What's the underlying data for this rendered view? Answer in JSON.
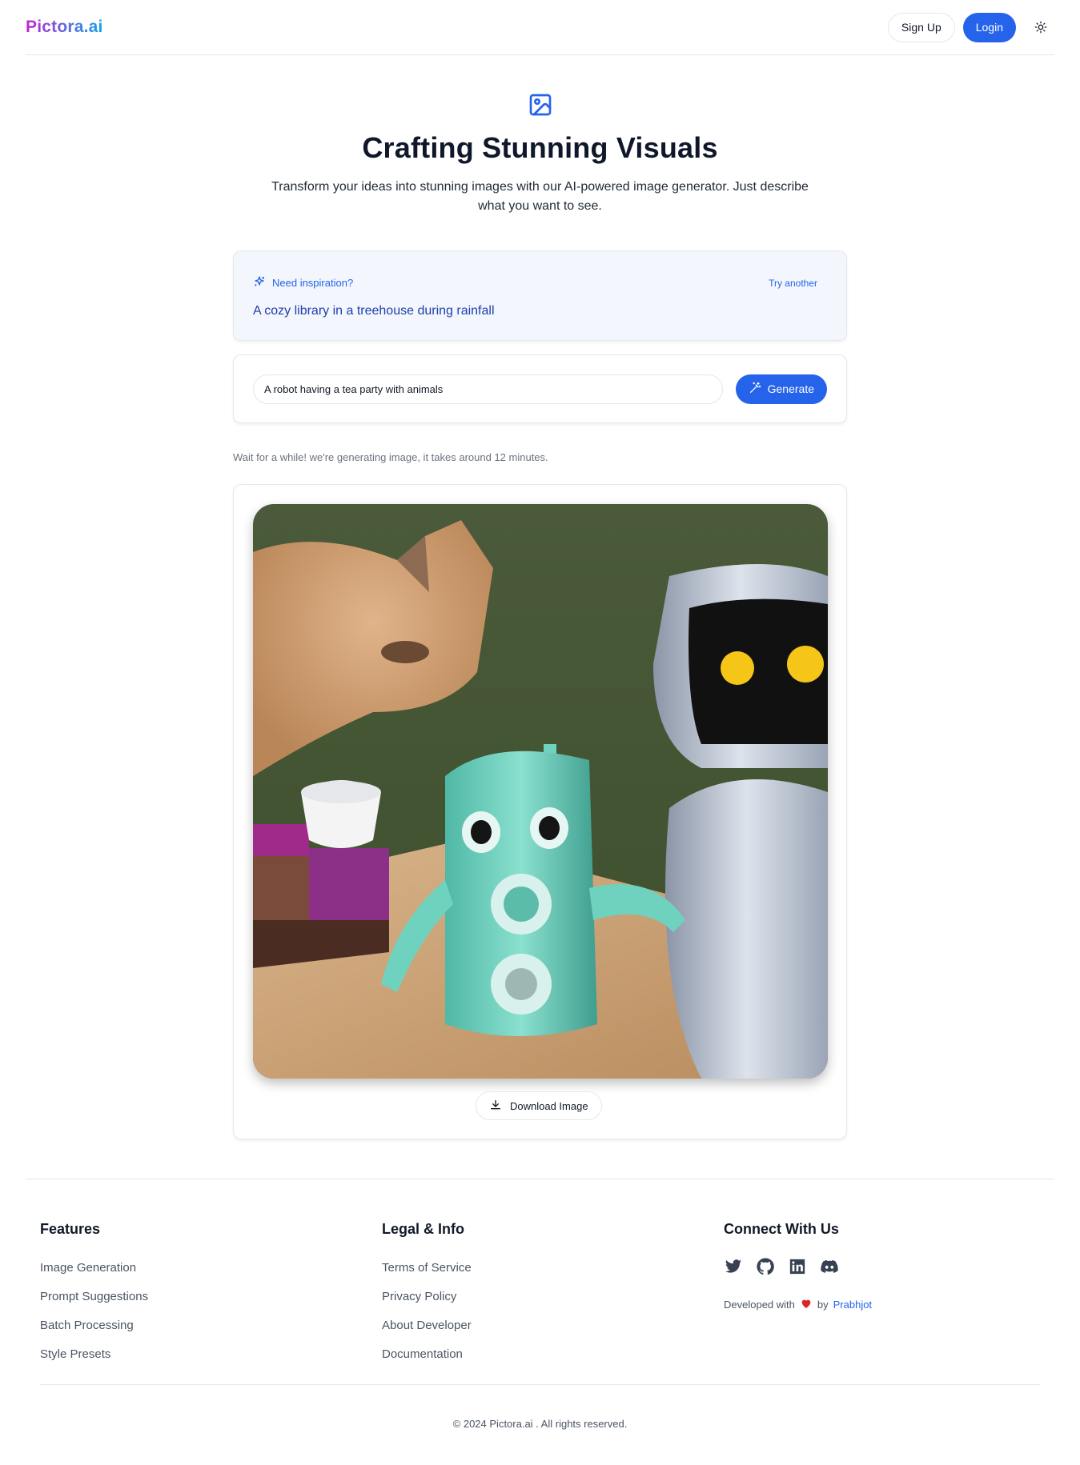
{
  "header": {
    "logo": "Pictora.ai",
    "signup_label": "Sign Up",
    "login_label": "Login",
    "theme_icon": "sun-icon"
  },
  "hero": {
    "icon": "image-icon",
    "title": "Crafting Stunning Visuals",
    "subtitle": "Transform your ideas into stunning images with our AI-powered image generator. Just describe what you want to see."
  },
  "inspiration": {
    "icon": "sparkles-icon",
    "label": "Need inspiration?",
    "try_another": "Try another",
    "prompt": "A cozy library in a treehouse during rainfall"
  },
  "form": {
    "prompt_value": "A robot having a tea party with animals",
    "generate_label": "Generate",
    "generate_icon": "magic-wand-icon"
  },
  "status": {
    "message": "Wait for a while! we're generating image, it takes around 12 minutes."
  },
  "result": {
    "download_label": "Download Image",
    "download_icon": "download-icon"
  },
  "footer": {
    "features": {
      "title": "Features",
      "items": [
        "Image Generation",
        "Prompt Suggestions",
        "Batch Processing",
        "Style Presets"
      ]
    },
    "legal": {
      "title": "Legal & Info",
      "items": [
        "Terms of Service",
        "Privacy Policy",
        "About Developer",
        "Documentation"
      ]
    },
    "connect": {
      "title": "Connect With Us",
      "socials": [
        "twitter-icon",
        "github-icon",
        "linkedin-icon",
        "discord-icon"
      ],
      "developed_prefix": "Developed with",
      "developed_by": "by",
      "author": "Prabhjot"
    },
    "copyright": "© 2024 Pictora.ai . All rights reserved."
  },
  "colors": {
    "primary": "#2563eb",
    "inspiration_bg": "#f3f6fc",
    "heart": "#dc2626",
    "logo_gradient_start": "#c026d3",
    "logo_gradient_end": "#0ea5e9"
  }
}
